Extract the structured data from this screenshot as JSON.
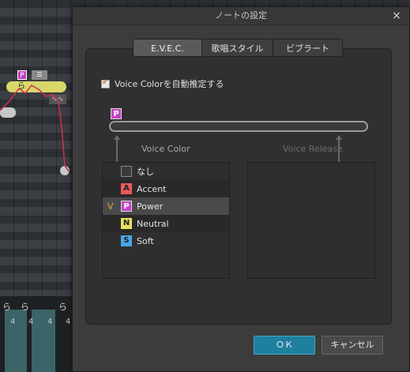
{
  "dialog": {
    "title": "ノートの設定",
    "close_label": "×"
  },
  "tabs": [
    {
      "label": "E.V.E.C.",
      "active": true
    },
    {
      "label": "歌唱スタイル",
      "active": false
    },
    {
      "label": "ビブラート",
      "active": false
    }
  ],
  "auto_estimate": {
    "label": "Voice Colorを自動推定する",
    "checked": true
  },
  "slider": {
    "badge": "P",
    "badge_color": "#c844c8"
  },
  "columns": {
    "voice_color": "Voice Color",
    "voice_release": "Voice Release"
  },
  "voice_color_items": [
    {
      "badge": "",
      "label": "なし",
      "color": "#3a3a3a",
      "selected": false,
      "mark": ""
    },
    {
      "badge": "A",
      "label": "Accent",
      "color": "#e85a5a",
      "selected": false,
      "mark": ""
    },
    {
      "badge": "P",
      "label": "Power",
      "color": "#c844c8",
      "selected": true,
      "mark": "V"
    },
    {
      "badge": "N",
      "label": "Neutral",
      "color": "#e8e060",
      "selected": false,
      "mark": ""
    },
    {
      "badge": "S",
      "label": "Soft",
      "color": "#4aa6e8",
      "selected": false,
      "mark": ""
    }
  ],
  "voice_release_items": [],
  "buttons": {
    "ok": "ＯＫ",
    "cancel": "キャンセル"
  },
  "background": {
    "note_lyric": "ら",
    "note_badge": "P",
    "vibrato_glyph": "∿∿",
    "wave_labels": [
      "ら",
      "ら",
      "ら"
    ],
    "wave_numbers": [
      "4",
      "4",
      "4",
      "4"
    ]
  }
}
